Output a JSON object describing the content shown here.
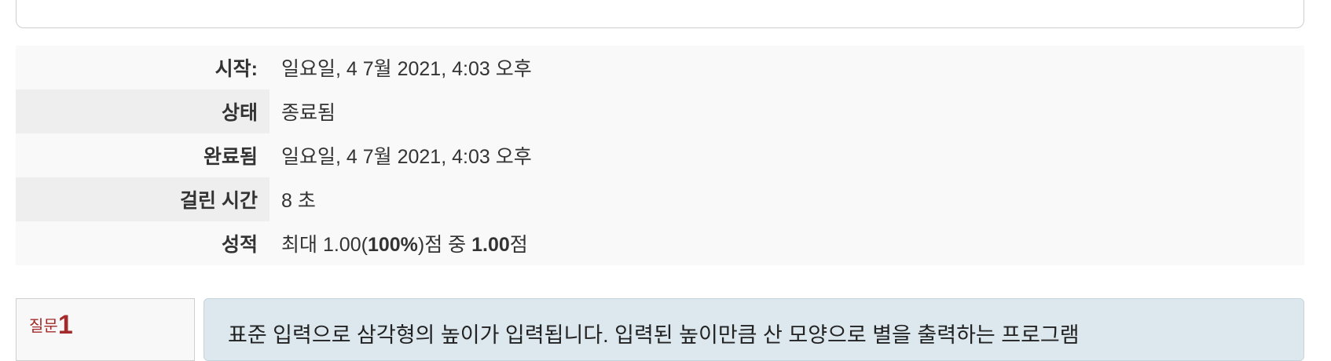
{
  "summary": {
    "rows": [
      {
        "label": "시작:",
        "value": "일요일, 4 7월 2021, 4:03 오후"
      },
      {
        "label": "상태",
        "value": "종료됨"
      },
      {
        "label": "완료됨",
        "value": "일요일, 4 7월 2021, 4:03 오후"
      },
      {
        "label": "걸린 시간",
        "value": "8 초"
      },
      {
        "label": "성적",
        "value_prefix": "최대 1.00(",
        "value_max_percent": "100%",
        "value_middle": ")점 중 ",
        "value_score": "1.00",
        "value_suffix": "점"
      }
    ]
  },
  "question": {
    "label": "질문",
    "number": "1",
    "text": "표준 입력으로 삼각형의 높이가 입력됩니다. 입력된 높이만큼 산 모양으로 별을 출력하는 프로그램"
  }
}
